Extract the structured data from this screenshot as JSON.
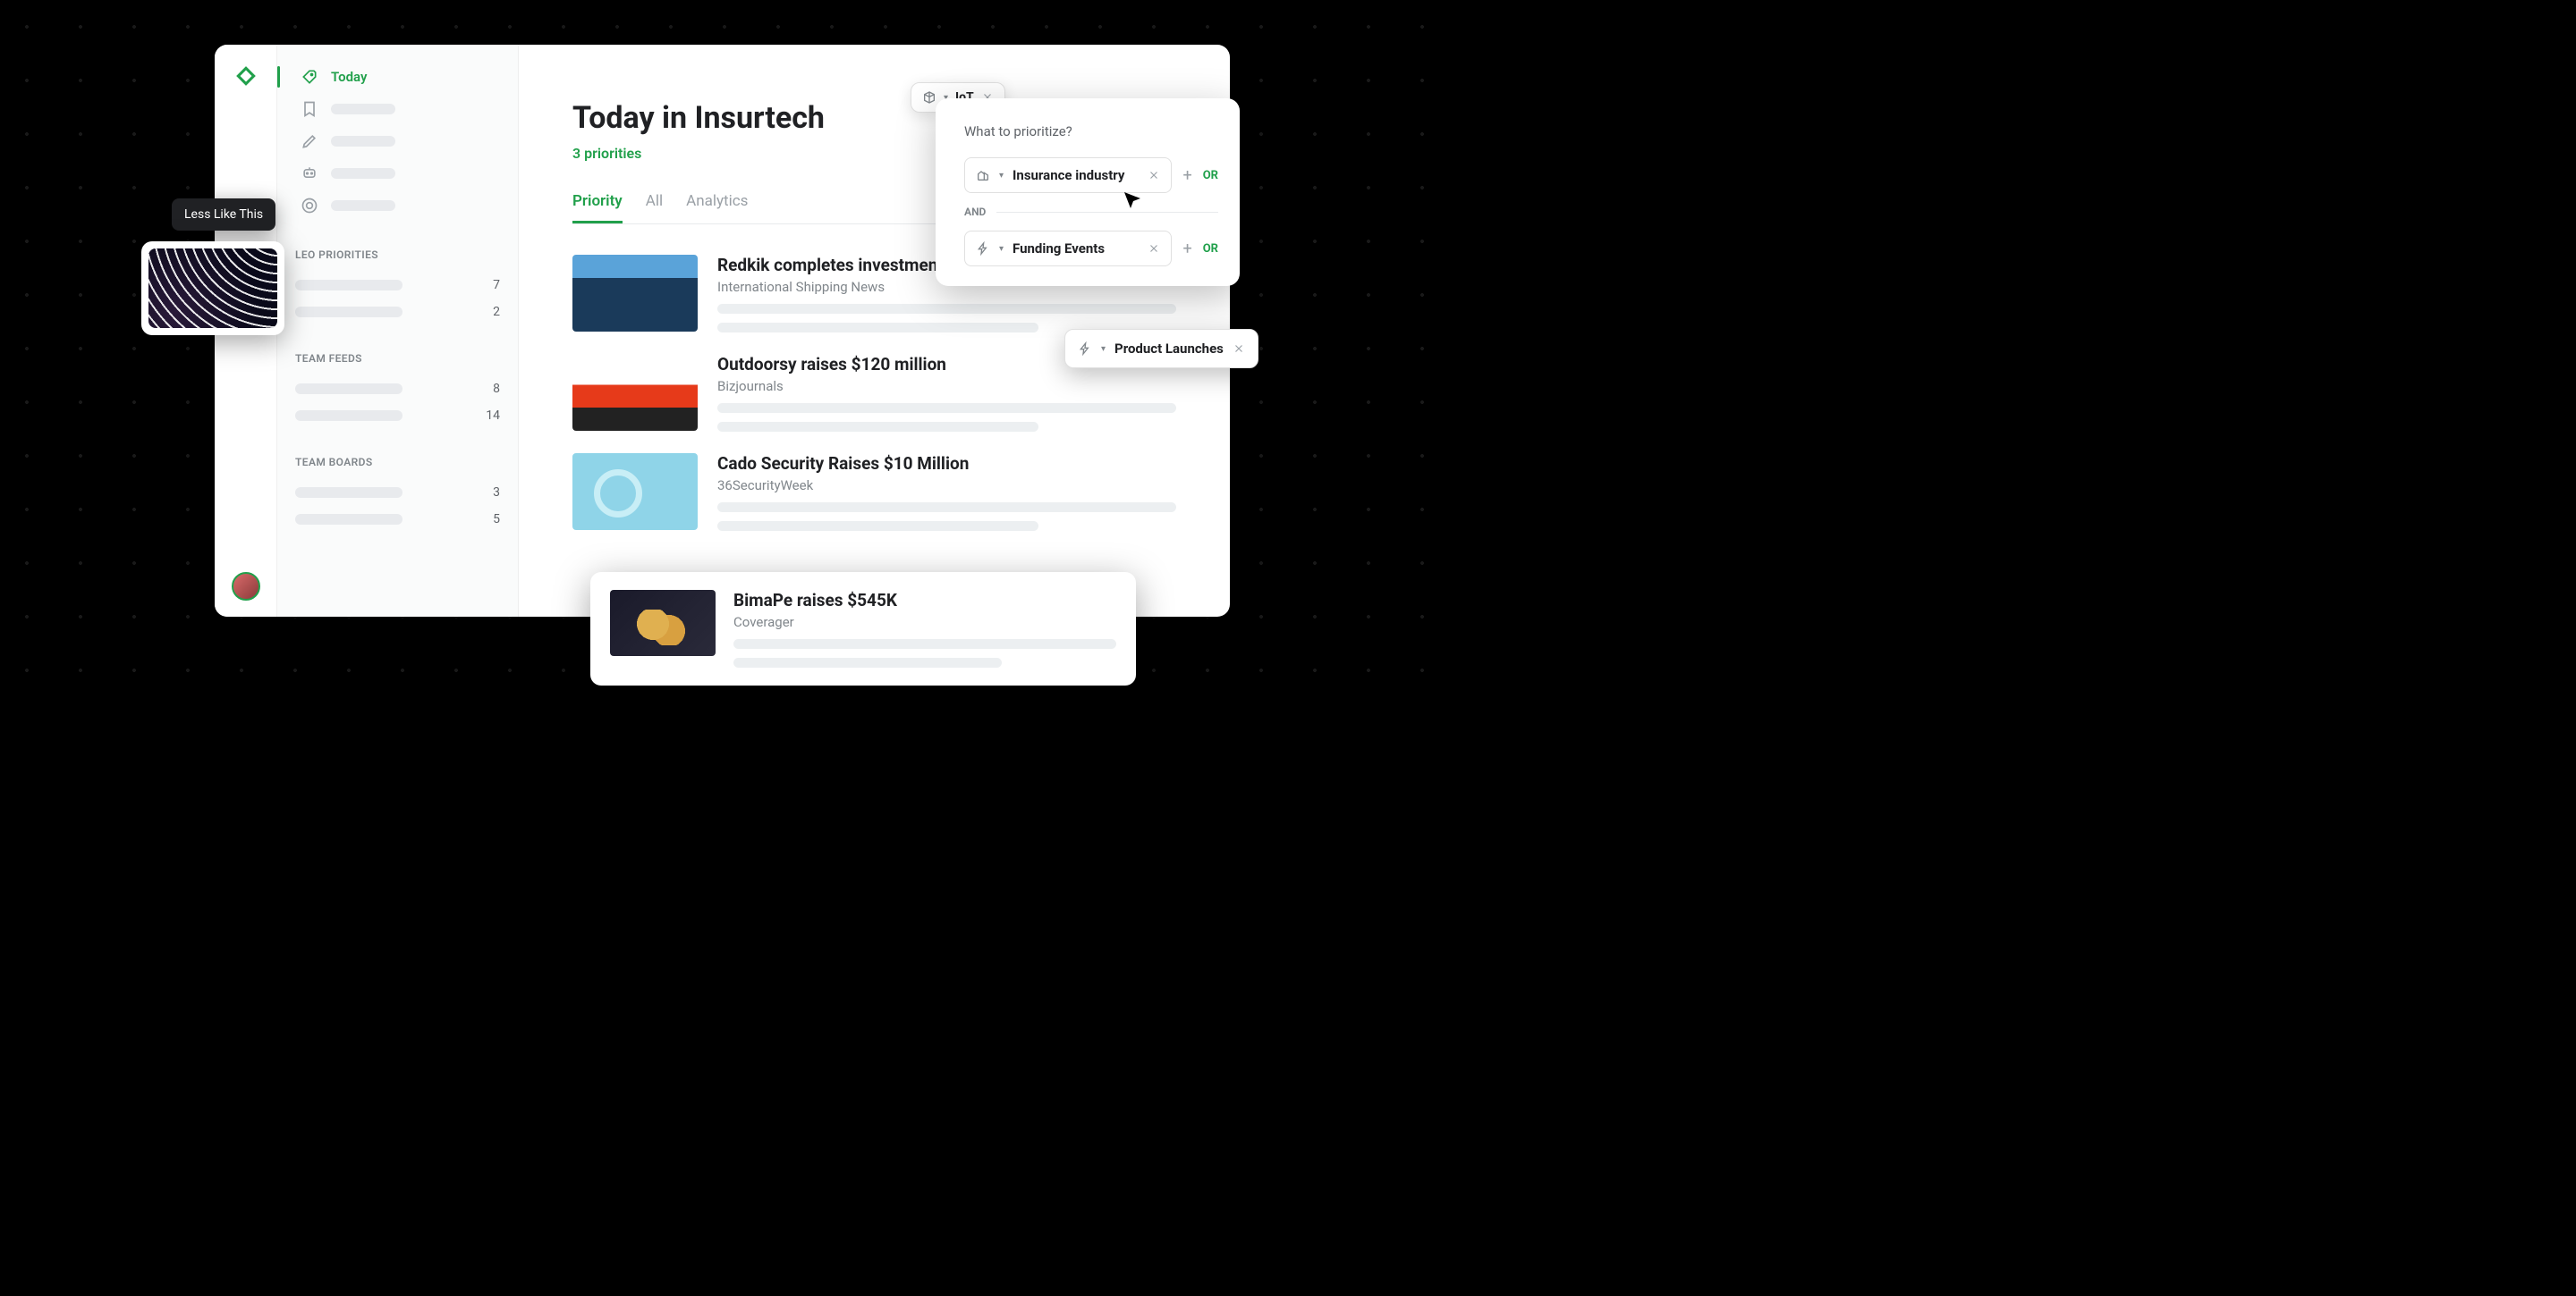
{
  "nav": {
    "active_label": "Today"
  },
  "sidebar": {
    "sections": [
      {
        "title": "LEO PRIORITIES",
        "counts": [
          "7",
          "2"
        ]
      },
      {
        "title": "TEAM FEEDS",
        "counts": [
          "8",
          "14"
        ]
      },
      {
        "title": "TEAM BOARDS",
        "counts": [
          "3",
          "5"
        ]
      }
    ]
  },
  "header": {
    "title": "Today in Insurtech",
    "subtitle": "3 priorities"
  },
  "tabs": {
    "priority": "Priority",
    "all": "All",
    "analytics": "Analytics"
  },
  "articles": [
    {
      "title": "Redkik completes investment",
      "source": "International Shipping News",
      "thumb": "blue"
    },
    {
      "title": "Outdoorsy raises $120 million",
      "source": "Bizjournals",
      "thumb": "car"
    },
    {
      "title": "Cado Security Raises $10 Million",
      "source": "36SecurityWeek",
      "thumb": "mag"
    }
  ],
  "float_article": {
    "title": "BimaPe raises $545K",
    "source": "Coverager"
  },
  "tooltip": {
    "less_like_this": "Less Like This"
  },
  "filters": {
    "iot": "IoT",
    "prompt": "What to prioritize?",
    "insurance": "Insurance industry",
    "funding": "Funding Events",
    "and": "AND",
    "or": "OR",
    "product_launches": "Product Launches"
  }
}
